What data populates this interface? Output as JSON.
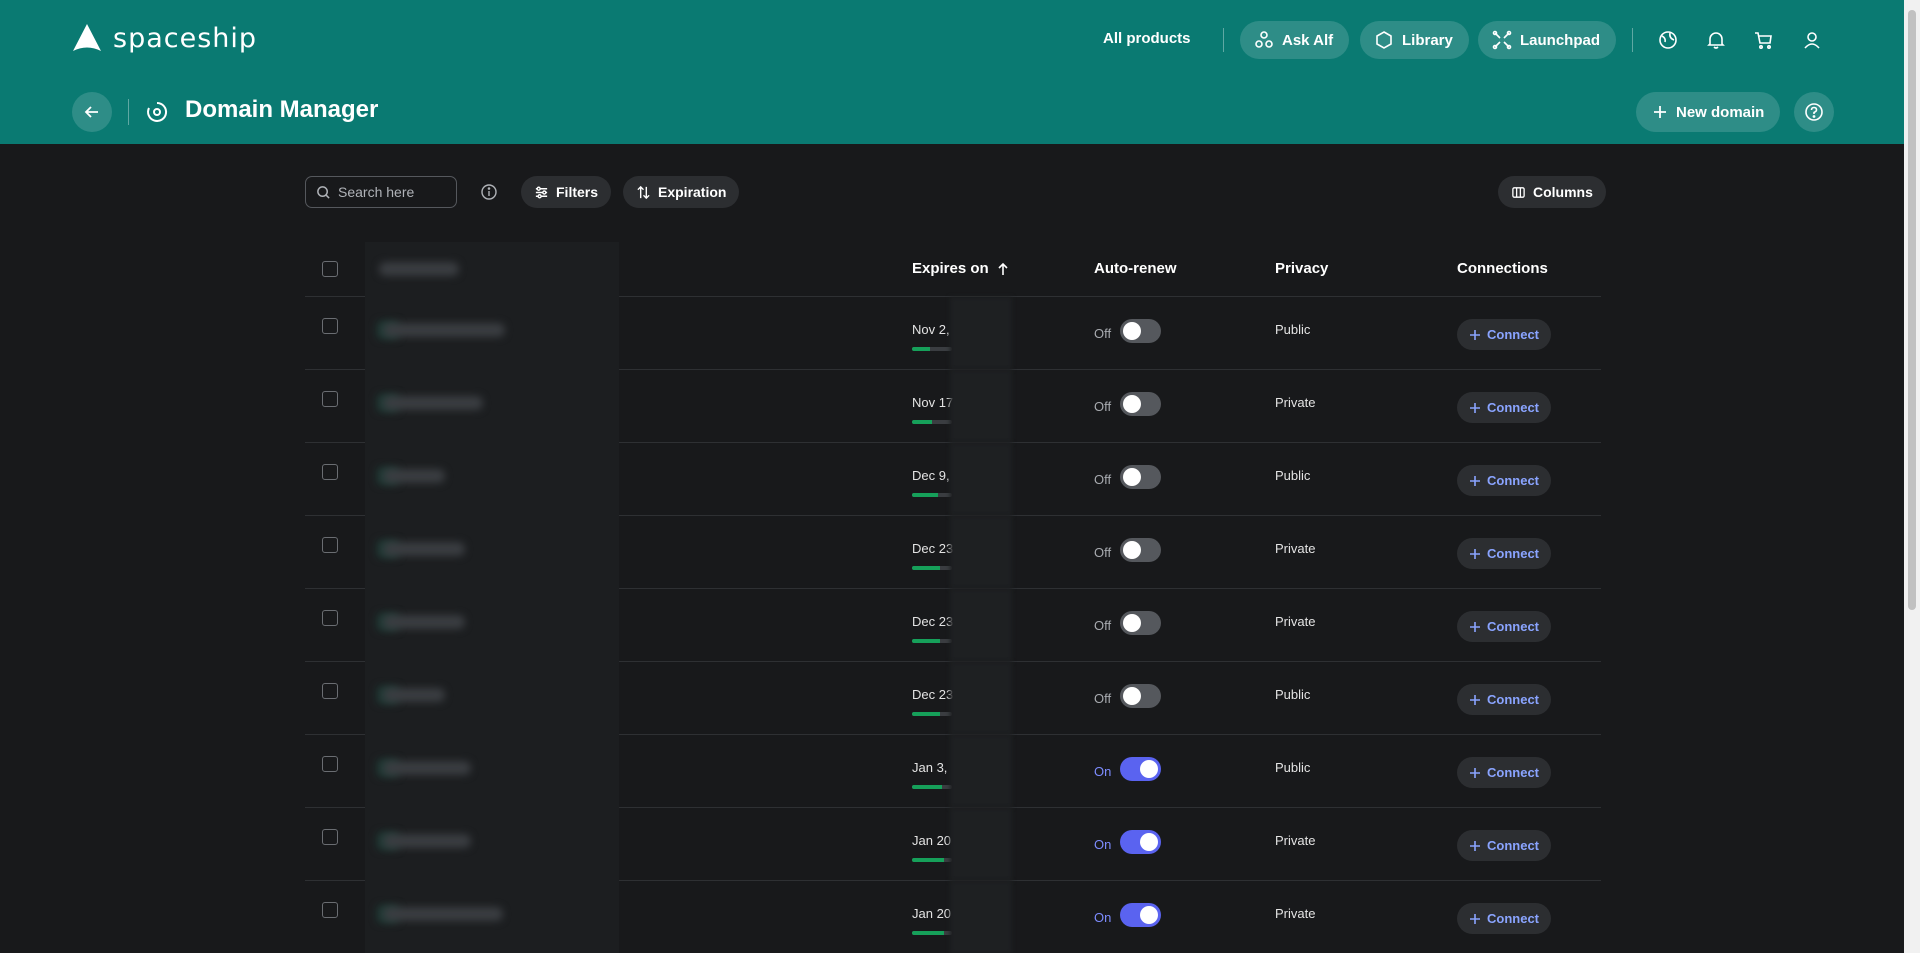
{
  "brand": {
    "name": "spaceship"
  },
  "topnav": {
    "all_products": "All products",
    "ask_alf": "Ask Alf",
    "library": "Library",
    "launchpad": "Launchpad"
  },
  "page": {
    "title": "Domain Manager",
    "new_domain": "New domain"
  },
  "toolbar": {
    "search_placeholder": "Search here",
    "filters": "Filters",
    "sort": "Expiration",
    "columns": "Columns"
  },
  "table": {
    "headers": {
      "expires": "Expires on",
      "autorenew": "Auto-renew",
      "privacy": "Privacy",
      "connections": "Connections"
    },
    "connect_label": "Connect",
    "rows": [
      {
        "expires": "Nov 2,",
        "renew": "Off",
        "privacy": "Public",
        "progress": 0.45
      },
      {
        "expires": "Nov 17",
        "renew": "Off",
        "privacy": "Private",
        "progress": 0.5
      },
      {
        "expires": "Dec 9,",
        "renew": "Off",
        "privacy": "Public",
        "progress": 0.65
      },
      {
        "expires": "Dec 23",
        "renew": "Off",
        "privacy": "Private",
        "progress": 0.7
      },
      {
        "expires": "Dec 23",
        "renew": "Off",
        "privacy": "Private",
        "progress": 0.7
      },
      {
        "expires": "Dec 23",
        "renew": "Off",
        "privacy": "Public",
        "progress": 0.7
      },
      {
        "expires": "Jan 3,",
        "renew": "On",
        "privacy": "Public",
        "progress": 0.75
      },
      {
        "expires": "Jan 20",
        "renew": "On",
        "privacy": "Private",
        "progress": 0.8
      },
      {
        "expires": "Jan 20",
        "renew": "On",
        "privacy": "Private",
        "progress": 0.8
      }
    ]
  }
}
